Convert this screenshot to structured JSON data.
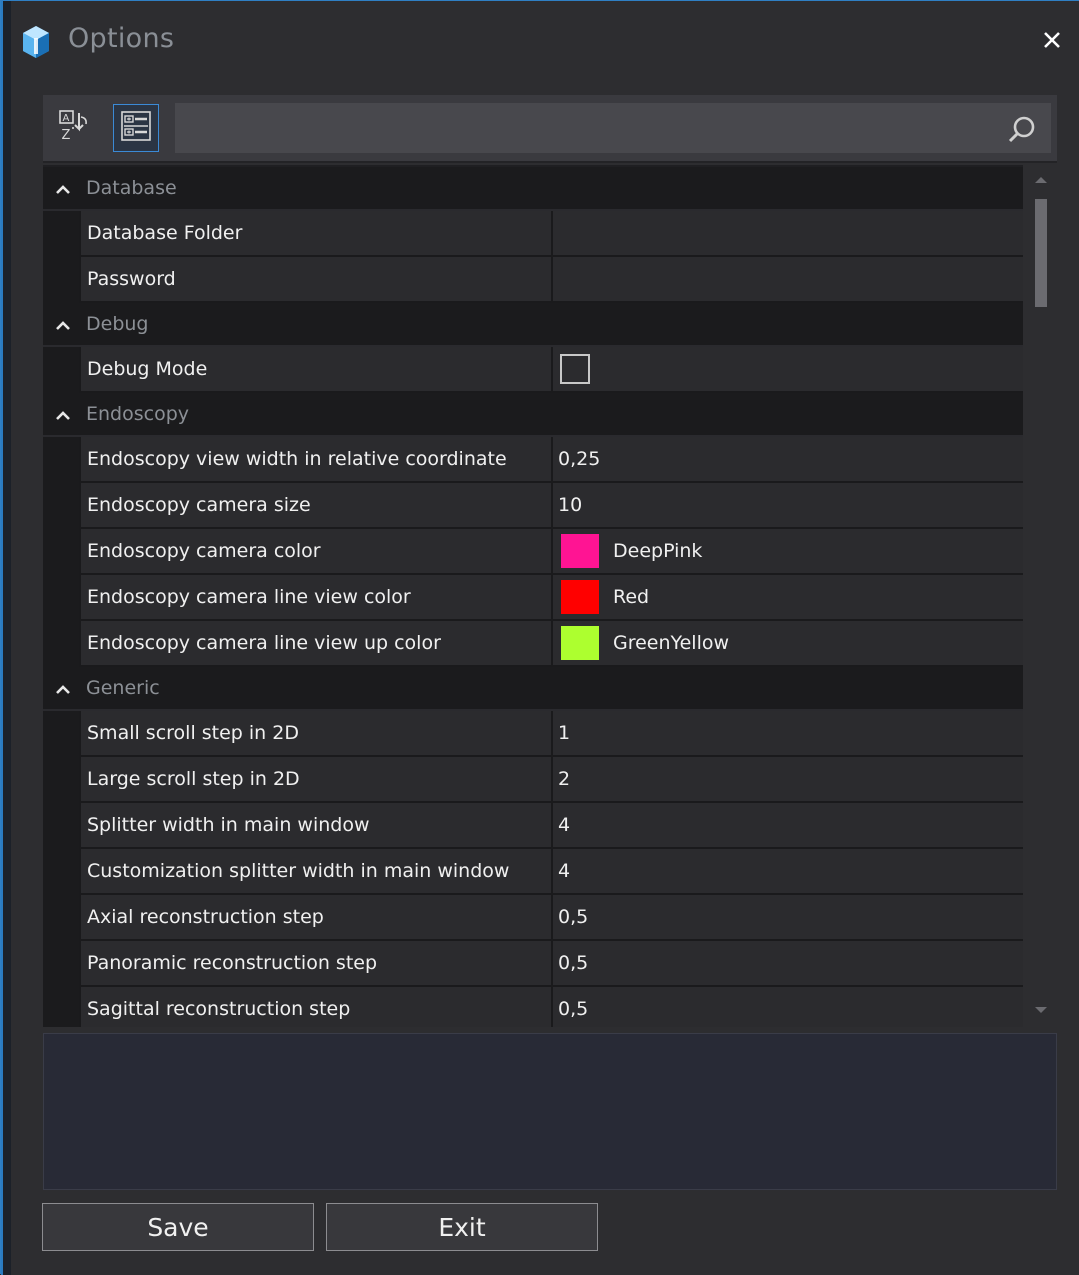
{
  "window": {
    "title": "Options"
  },
  "toolbar": {
    "sort_icon": "alphabetical-sort-icon",
    "category_icon": "categorized-view-icon",
    "search_placeholder": "",
    "search_value": ""
  },
  "grid": {
    "categories": [
      {
        "label": "Database",
        "properties": [
          {
            "name": "Database Folder",
            "value": ""
          },
          {
            "name": "Password",
            "value": ""
          }
        ]
      },
      {
        "label": "Debug",
        "properties": [
          {
            "name": "Debug Mode",
            "type": "checkbox",
            "checked": false
          }
        ]
      },
      {
        "label": "Endoscopy",
        "properties": [
          {
            "name": "Endoscopy view width in relative coordinate",
            "value": "0,25"
          },
          {
            "name": "Endoscopy camera size",
            "value": "10"
          },
          {
            "name": "Endoscopy camera color",
            "type": "color",
            "value": "DeepPink",
            "color": "#ff1493"
          },
          {
            "name": "Endoscopy camera line view color",
            "type": "color",
            "value": "Red",
            "color": "#ff0000"
          },
          {
            "name": "Endoscopy camera line view up color",
            "type": "color",
            "value": "GreenYellow",
            "color": "#adff2f"
          }
        ]
      },
      {
        "label": "Generic",
        "properties": [
          {
            "name": "Small scroll step in 2D",
            "value": "1"
          },
          {
            "name": "Large scroll step in 2D",
            "value": "2"
          },
          {
            "name": "Splitter width in main window",
            "value": "4"
          },
          {
            "name": "Customization splitter width in main window",
            "value": "4"
          },
          {
            "name": "Axial reconstruction step",
            "value": "0,5"
          },
          {
            "name": "Panoramic reconstruction step",
            "value": "0,5"
          },
          {
            "name": "Sagittal reconstruction step",
            "value": "0,5"
          }
        ]
      }
    ]
  },
  "footer": {
    "save_label": "Save",
    "exit_label": "Exit"
  },
  "colors": {
    "accent": "#2f7fc4",
    "background": "#2d2d30",
    "grid_cell": "#2b2b2e",
    "category_band": "#1b1b1d"
  }
}
